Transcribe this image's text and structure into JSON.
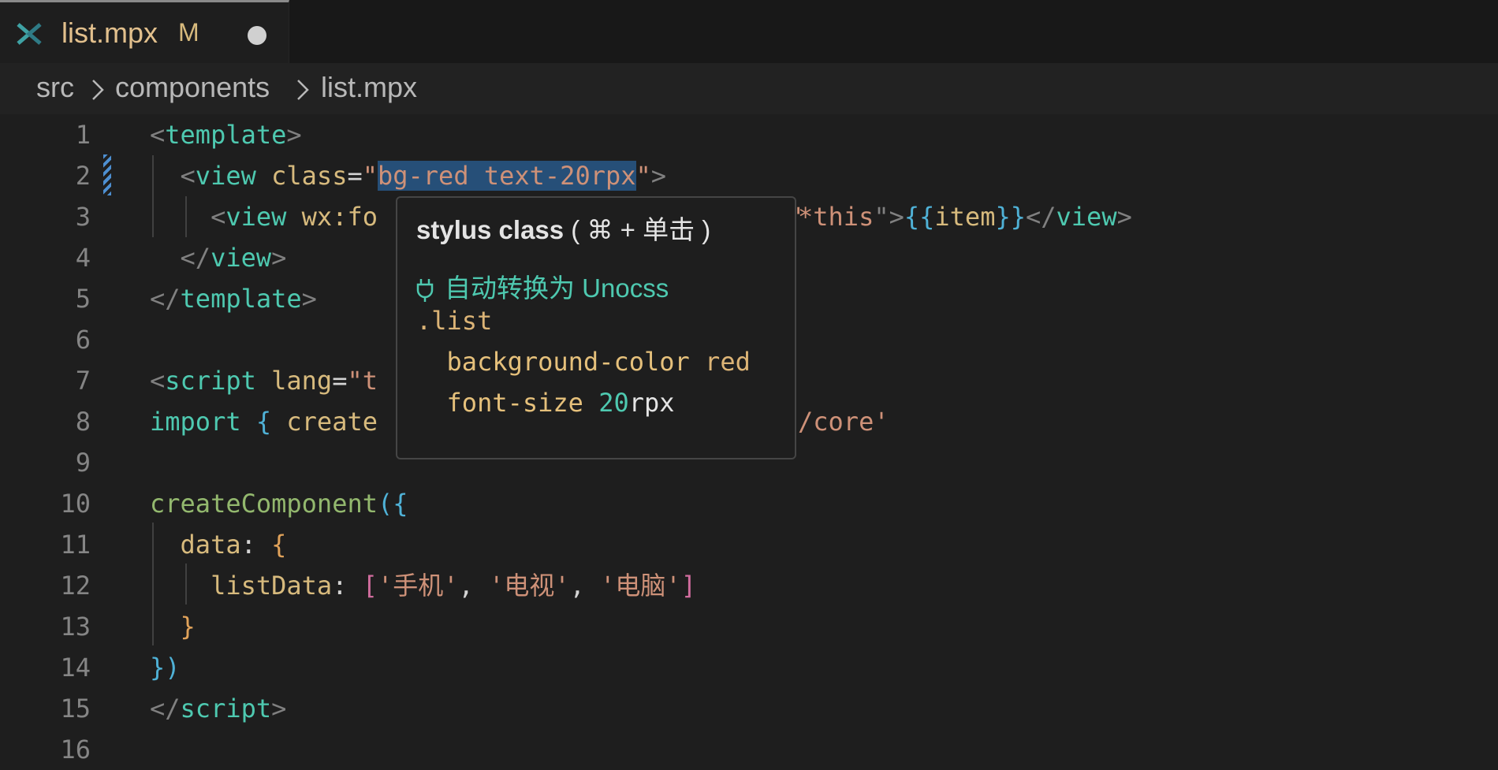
{
  "tab": {
    "title": "list.mpx",
    "modified": "M"
  },
  "breadcrumb": [
    "src",
    "components",
    "list.mpx"
  ],
  "lines": {
    "n": [
      "1",
      "2",
      "3",
      "4",
      "5",
      "6",
      "7",
      "8",
      "9",
      "10",
      "11",
      "12",
      "13",
      "14",
      "15",
      "16"
    ],
    "l1": {
      "open": "<",
      "tag": "template",
      "close": ">"
    },
    "l2": {
      "open": "<",
      "tag": "view",
      "attr": "class",
      "eq": "=",
      "q1": "\"",
      "value": "bg-red text-20rpx",
      "q2": "\"",
      "close": ">"
    },
    "l3": {
      "open": "<",
      "tag": "view",
      "attr": "wx:fo",
      "value": "*this",
      "close": "\">",
      "mus_open": "{{",
      "mus_content": "item",
      "mus_close": "}}",
      "endtag_open": "</",
      "endtag": "view",
      "endtag_close": ">"
    },
    "l4": {
      "open": "</",
      "tag": "view",
      "close": ">"
    },
    "l5": {
      "open": "</",
      "tag": "template",
      "close": ">"
    },
    "l7": {
      "open": "<",
      "tag": "script",
      "attr": "lang",
      "eq": "=",
      "q": "\"",
      "value": "t"
    },
    "l8": {
      "kw": "import",
      "brace": "{",
      "fn": "create",
      "str": "/core'"
    },
    "l10": {
      "fn": "createComponent",
      "paren": "(",
      "brace": "{"
    },
    "l11": {
      "prop": "data",
      "colon": ":",
      "brace": "{"
    },
    "l12": {
      "prop": "listData",
      "colon": ":",
      "bracket_open": "[",
      "items": [
        "'手机'",
        "'电视'",
        "'电脑'"
      ],
      "comma": ",",
      "bracket_close": "]"
    },
    "l13": {
      "brace": "}"
    },
    "l14": {
      "brace": "}",
      "paren": ")"
    },
    "l15": {
      "open": "</",
      "tag": "script",
      "close": ">"
    }
  },
  "hover": {
    "title": "stylus class",
    "shortcut": "( ⌘ + 单击 )",
    "link": "自动转换为 Unocss",
    "selector": ".list",
    "decl1": {
      "prop": "background-color",
      "value": "red"
    },
    "decl2": {
      "prop": "font-size",
      "num": "20",
      "unit": "rpx"
    }
  },
  "colors": {
    "background": "#1e1e1e",
    "tag": "#4ec9b0",
    "string": "#ce9178",
    "selection": "#264f78"
  }
}
